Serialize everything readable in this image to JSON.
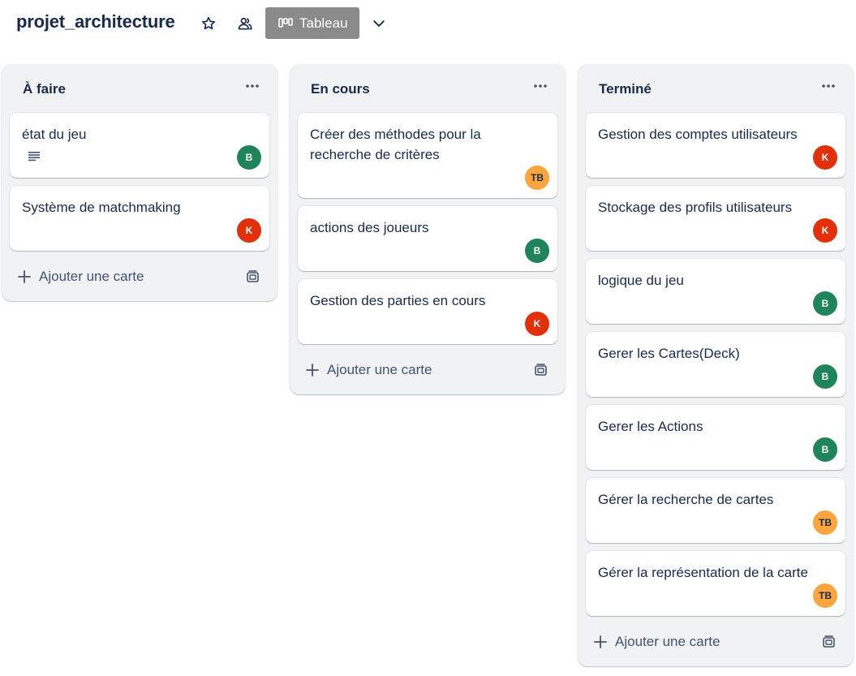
{
  "header": {
    "board_title": "projet_architecture",
    "star_icon": "star-icon",
    "visibility_icon": "people-icon",
    "view_button_label": "Tableau",
    "view_icon": "board-columns-icon",
    "dropdown_icon": "chevron-down-icon"
  },
  "lists": [
    {
      "title": "À faire",
      "cards": [
        {
          "title": "état du jeu",
          "has_description": true,
          "member": "B",
          "member_color": "#1f845a"
        },
        {
          "title": "Système de matchmaking",
          "member": "K",
          "member_color": "#e2300b"
        }
      ],
      "add_card_label": "Ajouter une carte"
    },
    {
      "title": "En cours",
      "cards": [
        {
          "title": "Créer des méthodes pour la recherche de critères",
          "member": "TB",
          "member_color": "#faa53d"
        },
        {
          "title": "actions des joueurs",
          "member": "B",
          "member_color": "#1f845a"
        },
        {
          "title": "Gestion des parties en cours",
          "member": "K",
          "member_color": "#e2300b"
        }
      ],
      "add_card_label": "Ajouter une carte"
    },
    {
      "title": "Terminé",
      "cards": [
        {
          "title": "Gestion des comptes utilisateurs",
          "member": "K",
          "member_color": "#e2300b"
        },
        {
          "title": "Stockage des profils utilisateurs",
          "member": "K",
          "member_color": "#e2300b"
        },
        {
          "title": "logique du jeu",
          "member": "B",
          "member_color": "#1f845a"
        },
        {
          "title": "Gerer les Cartes(Deck)",
          "member": "B",
          "member_color": "#1f845a"
        },
        {
          "title": "Gerer les Actions",
          "member": "B",
          "member_color": "#1f845a"
        },
        {
          "title": "Gérer la recherche de cartes",
          "member": "TB",
          "member_color": "#faa53d"
        },
        {
          "title": "Gérer la représentation de la carte",
          "member": "TB",
          "member_color": "#faa53d"
        }
      ],
      "add_card_label": "Ajouter une carte"
    }
  ],
  "colors": {
    "view_button_bg": "#8a8a8a",
    "list_bg": "#f1f2f4",
    "text_primary": "#172b4d",
    "text_secondary": "#44546f"
  }
}
